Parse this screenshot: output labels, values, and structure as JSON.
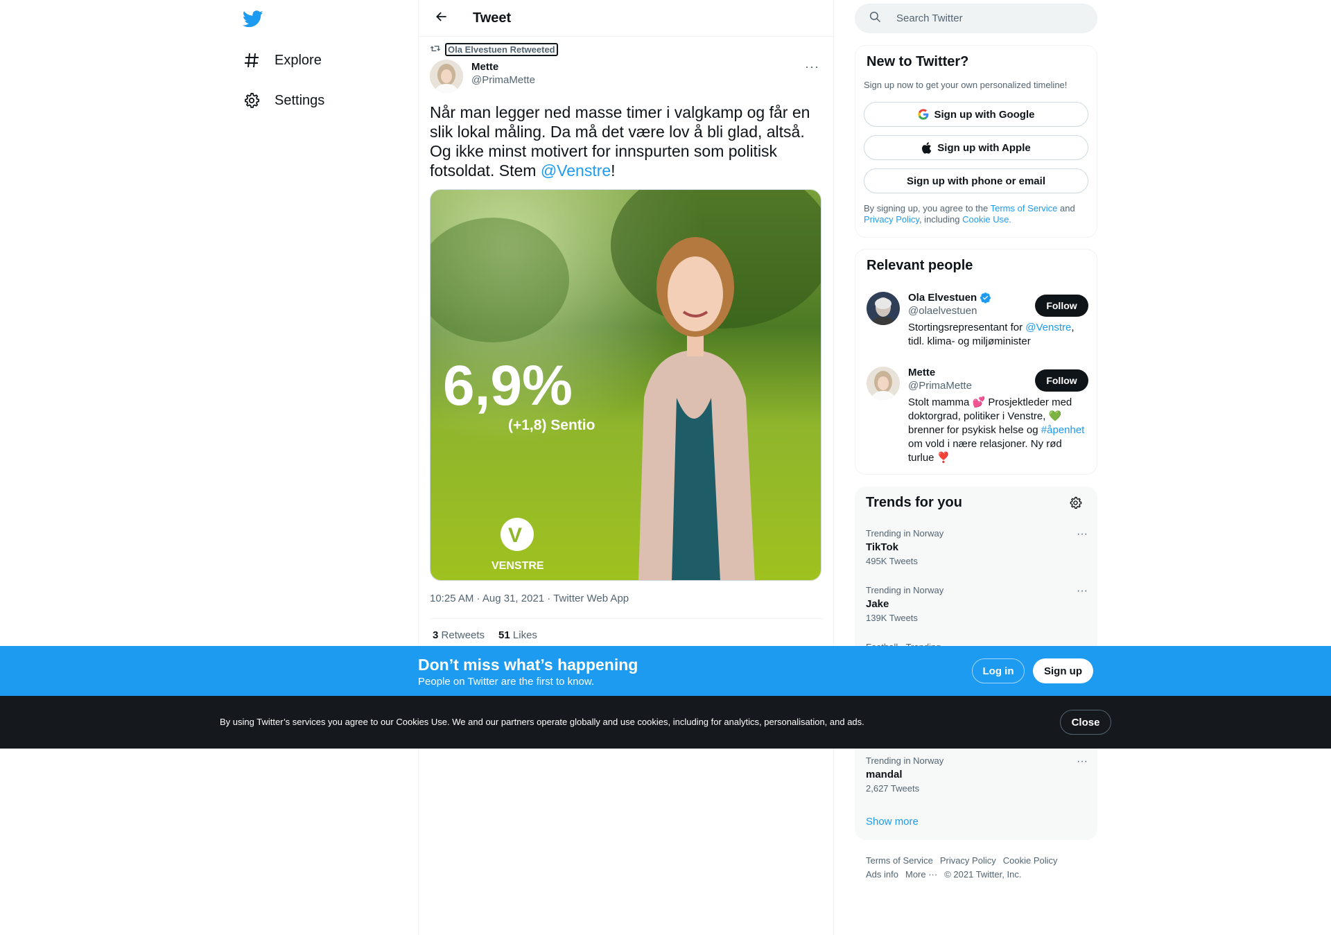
{
  "nav": {
    "logo_icon": "twitter-bird-icon",
    "items": [
      {
        "label": "Explore",
        "icon": "hashtag-icon"
      },
      {
        "label": "Settings",
        "icon": "gear-icon"
      }
    ]
  },
  "header": {
    "title": "Tweet",
    "back_icon": "arrow-left-icon"
  },
  "tweet": {
    "retweeted_by": "Ola Elvestuen Retweeted",
    "author_name": "Mette",
    "author_handle": "@PrimaMette",
    "text_before": "Når man legger ned masse timer i valgkamp og får en slik lokal måling. Da må det være lov å bli glad, altså. Og ikke minst motivert for innspurten som politisk fotsoldat. Stem ",
    "mention": "@Venstre",
    "text_after": "!",
    "image": {
      "big_number": "6,9%",
      "sub_number": "(+1,8) Sentio",
      "logo_text": "VENSTRE",
      "logo_letter": "V"
    },
    "timestamp": "10:25 AM · Aug 31, 2021 · Twitter Web App",
    "retweets_count": "3",
    "retweets_label": "Retweets",
    "likes_count": "51",
    "likes_label": "Likes"
  },
  "search": {
    "placeholder": "Search Twitter"
  },
  "new_to_twitter": {
    "title": "New to Twitter?",
    "subtitle": "Sign up now to get your own personalized timeline!",
    "google_label": "Sign up with Google",
    "apple_label": "Sign up with Apple",
    "phone_label": "Sign up with phone or email",
    "legal_1": "By signing up, you agree to the ",
    "terms": "Terms of Service",
    "legal_2": " and ",
    "privacy": "Privacy Policy",
    "legal_3": ", including ",
    "cookie": "Cookie Use."
  },
  "relevant": {
    "title": "Relevant people",
    "follow_label": "Follow",
    "people": [
      {
        "name": "Ola Elvestuen",
        "handle": "@olaelvestuen",
        "bio_1": "Stortingsrepresentant for ",
        "bio_mention": "@Venstre",
        "bio_2": ", tidl. klima- og miljøminister"
      },
      {
        "name": "Mette",
        "handle": "@PrimaMette",
        "bio_1": "Stolt mamma 💕 Prosjektleder med doktorgrad, politiker i Venstre, 💚 brenner for psykisk helse og ",
        "bio_mention": "#åpenhet",
        "bio_2": " om vold i nære relasjoner. Ny rød turlue ❣️"
      }
    ]
  },
  "trends": {
    "title": "Trends for you",
    "items": [
      {
        "context": "Trending in Norway",
        "name": "TikTok",
        "count": "495K Tweets"
      },
      {
        "context": "Trending in Norway",
        "name": "Jake",
        "count": "139K Tweets"
      },
      {
        "context": "Football · Trending",
        "name": "",
        "count": ""
      },
      {
        "context": "Trending in Norway",
        "name": "mandal",
        "count": "2,627 Tweets"
      }
    ],
    "show_more": "Show more"
  },
  "footer": {
    "links": [
      "Terms of Service",
      "Privacy Policy",
      "Cookie Policy",
      "Ads info",
      "More ···",
      "© 2021 Twitter, Inc."
    ]
  },
  "promo": {
    "title": "Don’t miss what’s happening",
    "subtitle": "People on Twitter are the first to know.",
    "login": "Log in",
    "signup": "Sign up"
  },
  "cookie_bar": {
    "text": "By using Twitter’s services you agree to our Cookies Use. We and our partners operate globally and use cookies, including for analytics, personalisation, and ads.",
    "close": "Close"
  },
  "colors": {
    "accent": "#1d9bf0",
    "text": "#0f1419",
    "muted": "#536471",
    "cookie_bg": "#15181c"
  }
}
